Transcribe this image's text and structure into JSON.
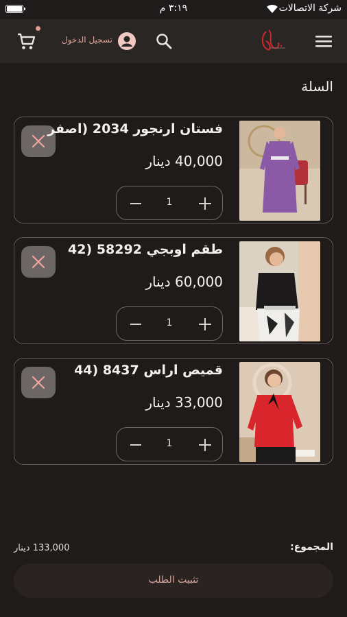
{
  "status_bar": {
    "time": "٣:١٩ م",
    "carrier": "شركة الاتصالات"
  },
  "header": {
    "login_label": "تسجيل الدخول"
  },
  "page": {
    "title": "السلة"
  },
  "cart": {
    "items": [
      {
        "name": "فستان ارنجور 2034 (اصفر",
        "price": "40,000 دينار",
        "quantity": "1"
      },
      {
        "name": "طقم اوبجي 58292 (42",
        "price": "60,000 دينار",
        "quantity": "1"
      },
      {
        "name": "قميص اراس 8437 (44",
        "price": "33,000 دينار",
        "quantity": "1"
      }
    ],
    "total_label": "المجموع:",
    "total_value": "133,000 دينار",
    "checkout_label": "تثبيت الطلب"
  },
  "colors": {
    "background": "#1f1b1a",
    "appbar": "#2a2624",
    "accent": "#e1a59c",
    "remove_button": "#6c6766"
  },
  "icons": [
    "battery-icon",
    "wifi-icon",
    "cart-icon",
    "user-icon",
    "search-icon",
    "logo",
    "menu-icon",
    "close-icon",
    "minus-icon",
    "plus-icon"
  ]
}
